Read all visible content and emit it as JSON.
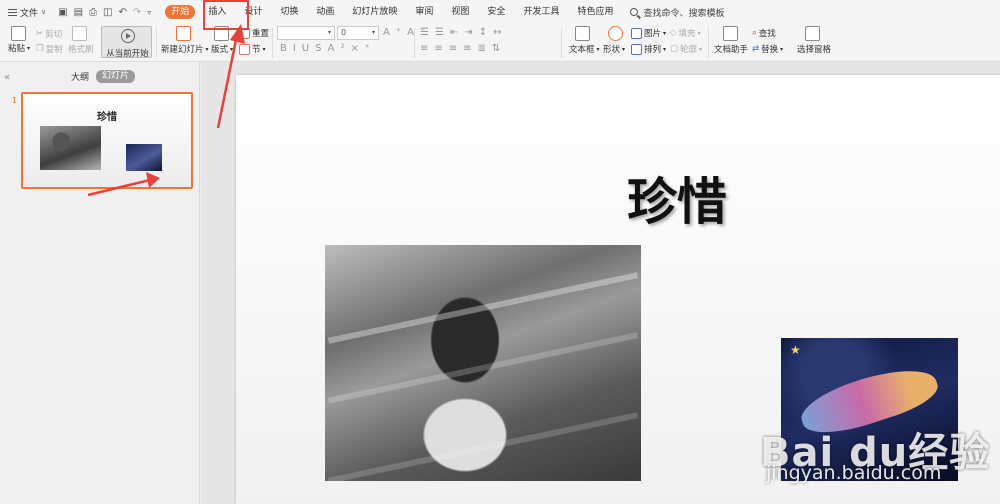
{
  "menu": {
    "file_label": "文件",
    "tabs": [
      "开始",
      "插入",
      "设计",
      "切换",
      "动画",
      "幻灯片放映",
      "审阅",
      "视图",
      "安全",
      "开发工具",
      "特色应用"
    ],
    "active_tab": "开始",
    "search_label": "查找命令、搜索模板"
  },
  "ribbon": {
    "paste": "粘贴",
    "cut": "剪切",
    "copy": "复制",
    "format_painter": "格式刷",
    "play_from_current": "从当前开始",
    "new_slide": "新建幻灯片",
    "layout": "版式",
    "reset": "重置",
    "section": "节",
    "font_size": "0",
    "textbox": "文本框",
    "shape": "形状",
    "picture": "图片",
    "fill": "填充",
    "arrange": "排列",
    "outline": "轮廓",
    "doc_assistant": "文档助手",
    "find": "查找",
    "replace": "替换",
    "select_pane": "选择窗格"
  },
  "left_panel": {
    "tab_outline": "大纲",
    "tab_slides": "幻灯片",
    "slide_number": "1",
    "thumb_title": "珍惜"
  },
  "slide": {
    "title": "珍惜"
  },
  "watermark": {
    "brand": "Bai du经验",
    "url": "jingyan.baidu.com"
  },
  "colors": {
    "accent": "#f07434",
    "annotation": "#e8413a"
  }
}
